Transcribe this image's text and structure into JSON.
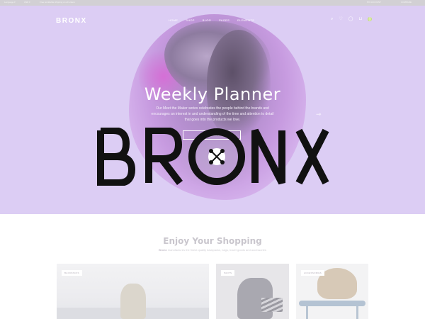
{
  "topbar": {
    "language": "Language ▾",
    "currency": "USD ▾",
    "promo": "Free worldwide shipping on all orders",
    "account": "MY ACCOUNT",
    "compare": "COMPARE"
  },
  "header": {
    "logo": "BRONX",
    "nav": [
      "HOME",
      "SHOP",
      "BLOG",
      "PAGES",
      "ELEMENTS"
    ],
    "icons": [
      "search-icon",
      "heart-icon",
      "user-icon",
      "cart-icon"
    ],
    "cart_count": "0"
  },
  "hero": {
    "title": "Weekly Planner",
    "description": "Our Meet the Maker series celebrates the people behind the brands and encourages an interest in and understanding of the time and attention to detail that goes into the products we love.",
    "button_label": "SHOP NOW",
    "next_arrow": "⇾"
  },
  "overlay_logo": {
    "text": "BRONX"
  },
  "shopping": {
    "title": "Enjoy Your Shopping",
    "brand": "Bronx",
    "description": " manufactures the finest quality backpacks, bags, travel goods and accessories"
  },
  "cards": [
    {
      "tag": "BACKPACKS"
    },
    {
      "tag": "PANTS"
    },
    {
      "tag": "ACCESSORIES"
    }
  ],
  "colors": {
    "hero_bg": "#dccdf4",
    "accent_badge": "#c6e07a",
    "logo_black": "#111111"
  }
}
